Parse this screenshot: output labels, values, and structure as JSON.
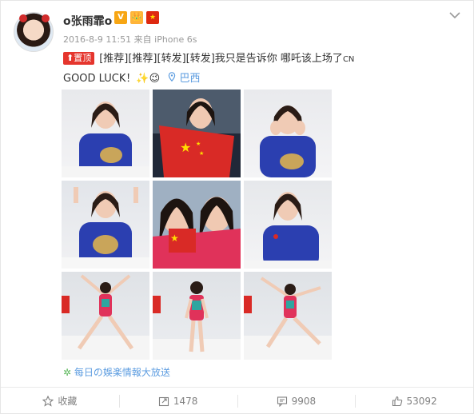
{
  "post": {
    "username": "o张雨霏o",
    "badges": [
      "V",
      "👑",
      "★"
    ],
    "timestamp": "2016-8-9 11:51",
    "source_device": "来自 iPhone 6s",
    "pinned_label": "置顶",
    "text_main": "[推荐][推荐][转发][转发]我只是告诉你 哪吒该上场了",
    "text_suffix": "CN",
    "text_line2": "GOOD LUCK！",
    "emoji_sparkle": "✨",
    "emoji_smile": "😉",
    "location": "巴西",
    "source_app": "每日の娛楽情報大放送"
  },
  "actions": {
    "favorite": "收藏",
    "repost_count": "1478",
    "comment_count": "9908",
    "like_count": "53092"
  },
  "colors": {
    "accent": "#eb7350",
    "link": "#5c9ce0",
    "pin": "#e5352d",
    "flag_red": "#de2910"
  },
  "photos": [
    {
      "kind": "portrait-blue"
    },
    {
      "kind": "portrait-flag"
    },
    {
      "kind": "portrait-blue"
    },
    {
      "kind": "portrait-blue"
    },
    {
      "kind": "selfie-flag"
    },
    {
      "kind": "portrait-blue"
    },
    {
      "kind": "swimsuit-jump"
    },
    {
      "kind": "swimsuit-stand"
    },
    {
      "kind": "swimsuit-jump"
    }
  ]
}
